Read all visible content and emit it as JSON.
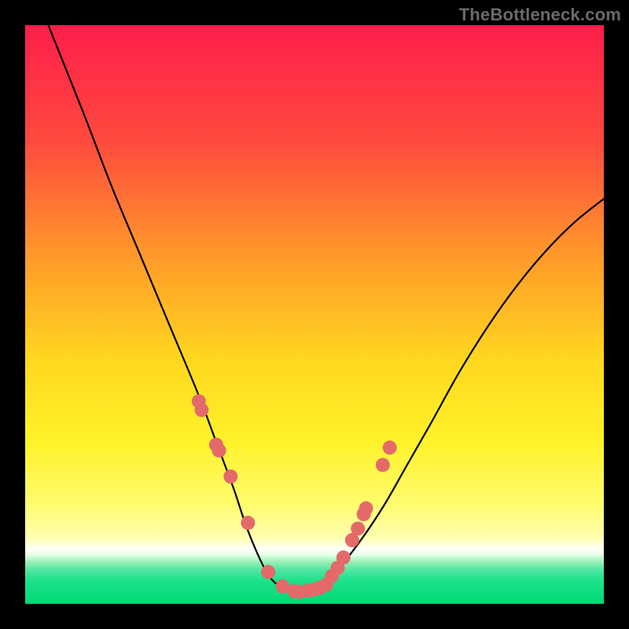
{
  "watermark": {
    "text": "TheBottleneck.com"
  },
  "chart_data": {
    "type": "line",
    "title": "",
    "xlabel": "",
    "ylabel": "",
    "xlim": [
      0,
      100
    ],
    "ylim": [
      0,
      100
    ],
    "curve": {
      "x": [
        4,
        10,
        15,
        20,
        25,
        30,
        33,
        36,
        38,
        40,
        42,
        44,
        46,
        48,
        50,
        54,
        58,
        62,
        66,
        70,
        75,
        80,
        85,
        90,
        95,
        100
      ],
      "y": [
        100,
        85,
        72,
        60,
        48,
        36,
        28,
        20,
        14,
        9,
        5,
        3,
        2,
        2,
        3,
        6,
        11,
        17,
        24,
        31,
        40,
        48,
        55,
        61,
        66,
        70
      ]
    },
    "markers": {
      "x": [
        30.0,
        30.5,
        33.0,
        33.5,
        35.5,
        38.5,
        42.0,
        44.5,
        46.5,
        47.5,
        49.0,
        50.0,
        51.0,
        52.0,
        53.0,
        54.0,
        55.0,
        56.5,
        57.5,
        58.5,
        58.9,
        61.8,
        63.0
      ],
      "y": [
        35.0,
        33.5,
        27.5,
        26.5,
        22.0,
        14.0,
        5.5,
        3.0,
        2.2,
        2.1,
        2.3,
        2.5,
        2.8,
        3.3,
        4.8,
        6.2,
        8.0,
        11.0,
        13.0,
        15.5,
        16.5,
        24.0,
        27.0
      ],
      "color": "#e46a6a",
      "radius": 9
    },
    "gradient_stops": [
      {
        "offset": 0.0,
        "color": "#ff1e4b"
      },
      {
        "offset": 0.2,
        "color": "#ff4a3e"
      },
      {
        "offset": 0.4,
        "color": "#ff9a2a"
      },
      {
        "offset": 0.58,
        "color": "#ffd81f"
      },
      {
        "offset": 0.72,
        "color": "#fff22a"
      },
      {
        "offset": 0.83,
        "color": "#fffc6f"
      },
      {
        "offset": 0.885,
        "color": "#ffffb0"
      },
      {
        "offset": 0.905,
        "color": "#fffff8"
      },
      {
        "offset": 0.915,
        "color": "#e8ffe8"
      },
      {
        "offset": 0.928,
        "color": "#96f0b5"
      },
      {
        "offset": 0.942,
        "color": "#4fe6a1"
      },
      {
        "offset": 0.96,
        "color": "#1ce28b"
      },
      {
        "offset": 1.0,
        "color": "#00d873"
      }
    ]
  }
}
